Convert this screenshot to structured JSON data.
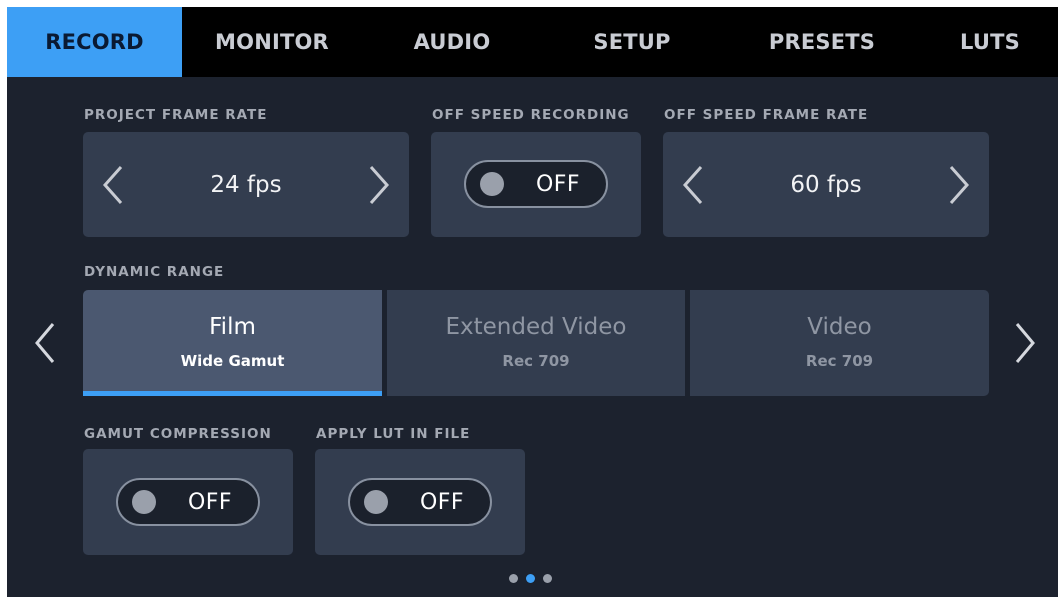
{
  "tabs": [
    {
      "label": "RECORD",
      "active": true
    },
    {
      "label": "MONITOR",
      "active": false
    },
    {
      "label": "AUDIO",
      "active": false
    },
    {
      "label": "SETUP",
      "active": false
    },
    {
      "label": "PRESETS",
      "active": false
    },
    {
      "label": "LUTS",
      "active": false
    }
  ],
  "project_frame_rate": {
    "label": "PROJECT FRAME RATE",
    "value": "24 fps"
  },
  "off_speed_recording": {
    "label": "OFF SPEED RECORDING",
    "state": "OFF"
  },
  "off_speed_frame_rate": {
    "label": "OFF SPEED FRAME RATE",
    "value": "60 fps"
  },
  "dynamic_range": {
    "label": "DYNAMIC RANGE",
    "options": [
      {
        "title": "Film",
        "subtitle": "Wide Gamut",
        "selected": true
      },
      {
        "title": "Extended Video",
        "subtitle": "Rec 709",
        "selected": false
      },
      {
        "title": "Video",
        "subtitle": "Rec 709",
        "selected": false
      }
    ]
  },
  "gamut_compression": {
    "label": "GAMUT COMPRESSION",
    "state": "OFF"
  },
  "apply_lut_in_file": {
    "label": "APPLY LUT IN FILE",
    "state": "OFF"
  },
  "pagination": {
    "total": 3,
    "current": 2
  },
  "icons": {
    "prev": "chevron-left-icon",
    "next": "chevron-right-icon"
  },
  "colors": {
    "accent": "#3d9ff5",
    "background": "#1c222e",
    "panel": "#333d4f",
    "panel_selected": "#4b5870",
    "tabbar": "#000000"
  }
}
